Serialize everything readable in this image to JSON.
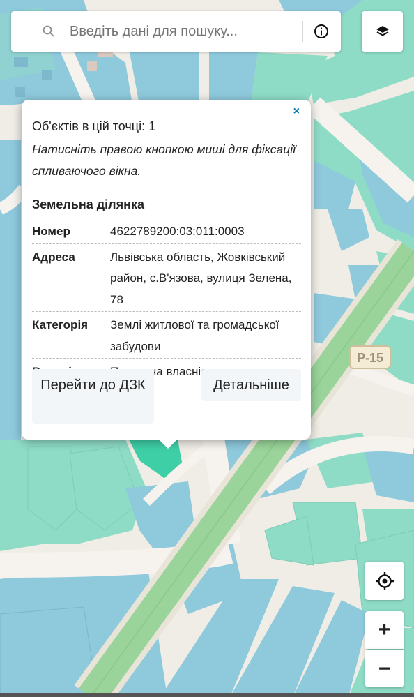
{
  "search": {
    "placeholder": "Введіть дані для пошуку...",
    "icon": "search-icon"
  },
  "toolbar": {
    "info_icon": "info-icon",
    "layers_icon": "layers-icon"
  },
  "map": {
    "road_label": "Р-15"
  },
  "popup": {
    "close": "×",
    "count": "Об'єктів в цій точці: 1",
    "hint": "Натисніть правою кнопкою миші для фіксації спливаючого вікна.",
    "section_title": "Земельна ділянка",
    "attributes": [
      {
        "key": "Номер",
        "value": "4622789200:03:011:0003"
      },
      {
        "key": "Адреса",
        "value": "Львівська область, Жовківський район, с.В'язова, вулиця Зелена, 78"
      },
      {
        "key": "Категорія",
        "value": "Землі житлової та громадської забудови"
      },
      {
        "key": "Власність",
        "value": "Приватна власність"
      }
    ],
    "btn_dzk": "Перейти до ДЗК",
    "btn_details": "Детальніше"
  },
  "controls": {
    "locate_icon": "crosshair-icon",
    "zoom_in": "+",
    "zoom_out": "−"
  },
  "colors": {
    "parcel_green": "#8fdcc6",
    "parcel_blue": "#8ec9dc",
    "selected_parcel": "#3ecfa6",
    "road": "#f6f3ee",
    "highway": "#9ad49a",
    "link": "#0078a8"
  }
}
